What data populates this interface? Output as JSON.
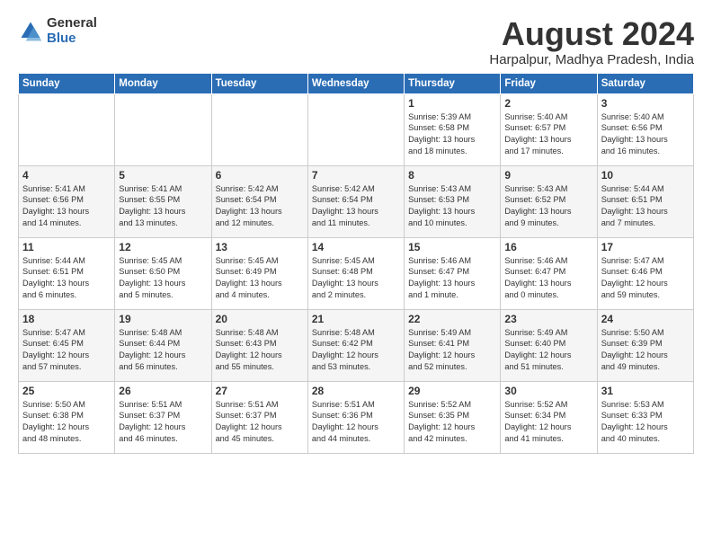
{
  "logo": {
    "general": "General",
    "blue": "Blue"
  },
  "title": "August 2024",
  "subtitle": "Harpalpur, Madhya Pradesh, India",
  "days_of_week": [
    "Sunday",
    "Monday",
    "Tuesday",
    "Wednesday",
    "Thursday",
    "Friday",
    "Saturday"
  ],
  "weeks": [
    [
      {
        "day": "",
        "content": ""
      },
      {
        "day": "",
        "content": ""
      },
      {
        "day": "",
        "content": ""
      },
      {
        "day": "",
        "content": ""
      },
      {
        "day": "1",
        "content": "Sunrise: 5:39 AM\nSunset: 6:58 PM\nDaylight: 13 hours\nand 18 minutes."
      },
      {
        "day": "2",
        "content": "Sunrise: 5:40 AM\nSunset: 6:57 PM\nDaylight: 13 hours\nand 17 minutes."
      },
      {
        "day": "3",
        "content": "Sunrise: 5:40 AM\nSunset: 6:56 PM\nDaylight: 13 hours\nand 16 minutes."
      }
    ],
    [
      {
        "day": "4",
        "content": "Sunrise: 5:41 AM\nSunset: 6:56 PM\nDaylight: 13 hours\nand 14 minutes."
      },
      {
        "day": "5",
        "content": "Sunrise: 5:41 AM\nSunset: 6:55 PM\nDaylight: 13 hours\nand 13 minutes."
      },
      {
        "day": "6",
        "content": "Sunrise: 5:42 AM\nSunset: 6:54 PM\nDaylight: 13 hours\nand 12 minutes."
      },
      {
        "day": "7",
        "content": "Sunrise: 5:42 AM\nSunset: 6:54 PM\nDaylight: 13 hours\nand 11 minutes."
      },
      {
        "day": "8",
        "content": "Sunrise: 5:43 AM\nSunset: 6:53 PM\nDaylight: 13 hours\nand 10 minutes."
      },
      {
        "day": "9",
        "content": "Sunrise: 5:43 AM\nSunset: 6:52 PM\nDaylight: 13 hours\nand 9 minutes."
      },
      {
        "day": "10",
        "content": "Sunrise: 5:44 AM\nSunset: 6:51 PM\nDaylight: 13 hours\nand 7 minutes."
      }
    ],
    [
      {
        "day": "11",
        "content": "Sunrise: 5:44 AM\nSunset: 6:51 PM\nDaylight: 13 hours\nand 6 minutes."
      },
      {
        "day": "12",
        "content": "Sunrise: 5:45 AM\nSunset: 6:50 PM\nDaylight: 13 hours\nand 5 minutes."
      },
      {
        "day": "13",
        "content": "Sunrise: 5:45 AM\nSunset: 6:49 PM\nDaylight: 13 hours\nand 4 minutes."
      },
      {
        "day": "14",
        "content": "Sunrise: 5:45 AM\nSunset: 6:48 PM\nDaylight: 13 hours\nand 2 minutes."
      },
      {
        "day": "15",
        "content": "Sunrise: 5:46 AM\nSunset: 6:47 PM\nDaylight: 13 hours\nand 1 minute."
      },
      {
        "day": "16",
        "content": "Sunrise: 5:46 AM\nSunset: 6:47 PM\nDaylight: 13 hours\nand 0 minutes."
      },
      {
        "day": "17",
        "content": "Sunrise: 5:47 AM\nSunset: 6:46 PM\nDaylight: 12 hours\nand 59 minutes."
      }
    ],
    [
      {
        "day": "18",
        "content": "Sunrise: 5:47 AM\nSunset: 6:45 PM\nDaylight: 12 hours\nand 57 minutes."
      },
      {
        "day": "19",
        "content": "Sunrise: 5:48 AM\nSunset: 6:44 PM\nDaylight: 12 hours\nand 56 minutes."
      },
      {
        "day": "20",
        "content": "Sunrise: 5:48 AM\nSunset: 6:43 PM\nDaylight: 12 hours\nand 55 minutes."
      },
      {
        "day": "21",
        "content": "Sunrise: 5:48 AM\nSunset: 6:42 PM\nDaylight: 12 hours\nand 53 minutes."
      },
      {
        "day": "22",
        "content": "Sunrise: 5:49 AM\nSunset: 6:41 PM\nDaylight: 12 hours\nand 52 minutes."
      },
      {
        "day": "23",
        "content": "Sunrise: 5:49 AM\nSunset: 6:40 PM\nDaylight: 12 hours\nand 51 minutes."
      },
      {
        "day": "24",
        "content": "Sunrise: 5:50 AM\nSunset: 6:39 PM\nDaylight: 12 hours\nand 49 minutes."
      }
    ],
    [
      {
        "day": "25",
        "content": "Sunrise: 5:50 AM\nSunset: 6:38 PM\nDaylight: 12 hours\nand 48 minutes."
      },
      {
        "day": "26",
        "content": "Sunrise: 5:51 AM\nSunset: 6:37 PM\nDaylight: 12 hours\nand 46 minutes."
      },
      {
        "day": "27",
        "content": "Sunrise: 5:51 AM\nSunset: 6:37 PM\nDaylight: 12 hours\nand 45 minutes."
      },
      {
        "day": "28",
        "content": "Sunrise: 5:51 AM\nSunset: 6:36 PM\nDaylight: 12 hours\nand 44 minutes."
      },
      {
        "day": "29",
        "content": "Sunrise: 5:52 AM\nSunset: 6:35 PM\nDaylight: 12 hours\nand 42 minutes."
      },
      {
        "day": "30",
        "content": "Sunrise: 5:52 AM\nSunset: 6:34 PM\nDaylight: 12 hours\nand 41 minutes."
      },
      {
        "day": "31",
        "content": "Sunrise: 5:53 AM\nSunset: 6:33 PM\nDaylight: 12 hours\nand 40 minutes."
      }
    ]
  ]
}
